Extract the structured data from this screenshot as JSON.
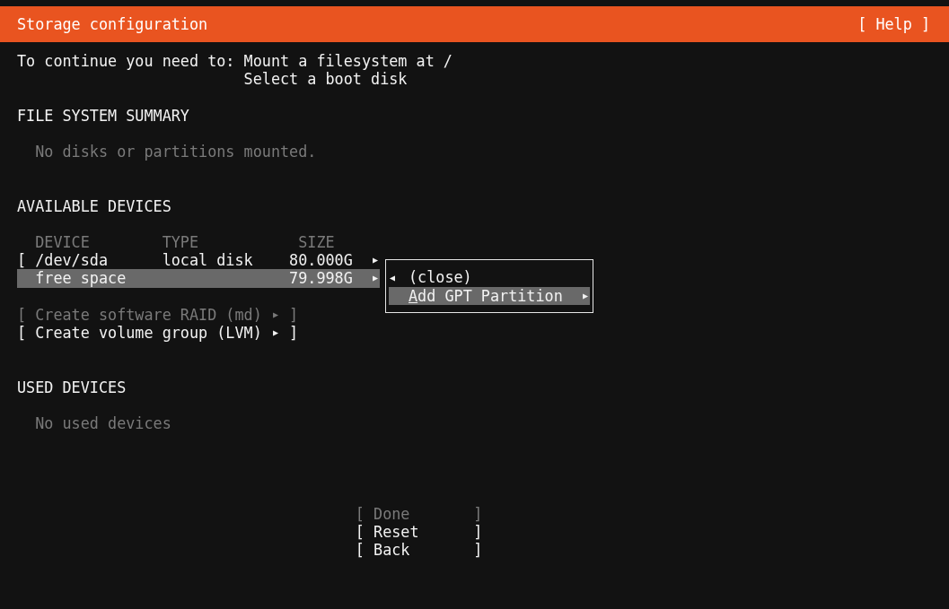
{
  "header": {
    "title": "Storage configuration",
    "help_button": "[ Help ]"
  },
  "requirements": {
    "label": "To continue you need to:",
    "items": [
      "Mount a filesystem at /",
      "Select a boot disk"
    ]
  },
  "file_system_summary": {
    "heading": "FILE SYSTEM SUMMARY",
    "message": "No disks or partitions mounted."
  },
  "available_devices": {
    "heading": "AVAILABLE DEVICES",
    "columns": [
      "DEVICE",
      "TYPE",
      "SIZE"
    ],
    "rows": [
      {
        "bracket": "[",
        "device": "/dev/sda",
        "type": "local disk",
        "size": "80.000G",
        "arrow": "▶",
        "selected": false
      },
      {
        "device": "free space",
        "size": "79.998G",
        "arrow": "▶",
        "selected": true
      }
    ],
    "menu": {
      "items": [
        {
          "kind": "close",
          "icon": "◀",
          "label": "(close)",
          "selected": false
        },
        {
          "kind": "submenu",
          "hotkey": "A",
          "label": "dd GPT Partition",
          "arrow": "▶",
          "selected": true
        }
      ]
    },
    "actions": [
      {
        "open": "[",
        "label": "Create software RAID (md)",
        "arrow": "▶",
        "close": "]",
        "disabled": true
      },
      {
        "open": "[",
        "label": "Create volume group (LVM)",
        "arrow": "▶",
        "close": "]",
        "disabled": false
      }
    ]
  },
  "used_devices": {
    "heading": "USED DEVICES",
    "message": "No used devices"
  },
  "buttons": [
    {
      "open": "[",
      "label": "Done",
      "close": "]",
      "disabled": true
    },
    {
      "open": "[",
      "label": "Reset",
      "close": "]",
      "disabled": false
    },
    {
      "open": "[",
      "label": "Back",
      "close": "]",
      "disabled": false
    }
  ]
}
